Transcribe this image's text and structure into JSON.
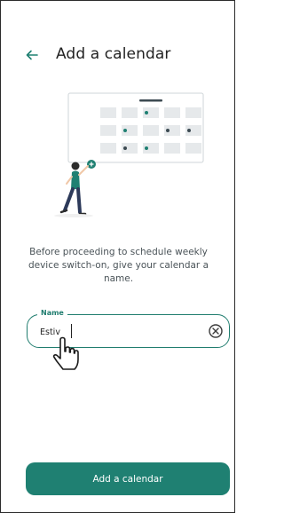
{
  "header": {
    "title": "Add a calendar",
    "back_icon": "arrow-left-icon"
  },
  "illustration": {
    "icon": "calendar-illustration"
  },
  "description": "Before proceeding to schedule weekly device switch-on, give your calendar a name.",
  "name_field": {
    "label": "Name",
    "value": "Estiv",
    "clear_icon": "clear-circle-icon"
  },
  "footer": {
    "submit_label": "Add a calendar"
  },
  "colors": {
    "accent": "#1f8072",
    "text": "#222222",
    "muted": "#4a5358"
  }
}
